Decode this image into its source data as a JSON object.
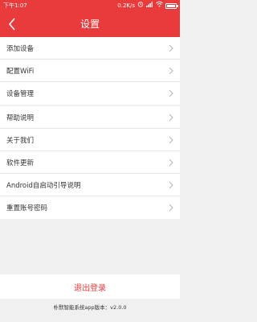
{
  "status_bar": {
    "time": "下午1:07",
    "network_speed": "0.2K/s",
    "icons": [
      "alarm-icon",
      "signal-icon",
      "wifi-icon",
      "battery-icon"
    ],
    "battery_level": 0.85
  },
  "header": {
    "title": "设置",
    "back_icon": "back-arrow-icon"
  },
  "settings": {
    "group1": [
      {
        "label": "添加设备"
      },
      {
        "label": "配置WiFi"
      },
      {
        "label": "设备管理"
      }
    ],
    "group2": [
      {
        "label": "帮助说明"
      },
      {
        "label": "关于我们"
      },
      {
        "label": "软件更新"
      },
      {
        "label": "Android自启动引导说明"
      },
      {
        "label": "重置账号密码"
      }
    ]
  },
  "footer": {
    "logout_label": "退出登录",
    "version_text": "朴默智能系统app版本：v2.0.0"
  },
  "colors": {
    "accent": "#e93b3b",
    "background": "#f0f0f0",
    "text": "#333333"
  }
}
